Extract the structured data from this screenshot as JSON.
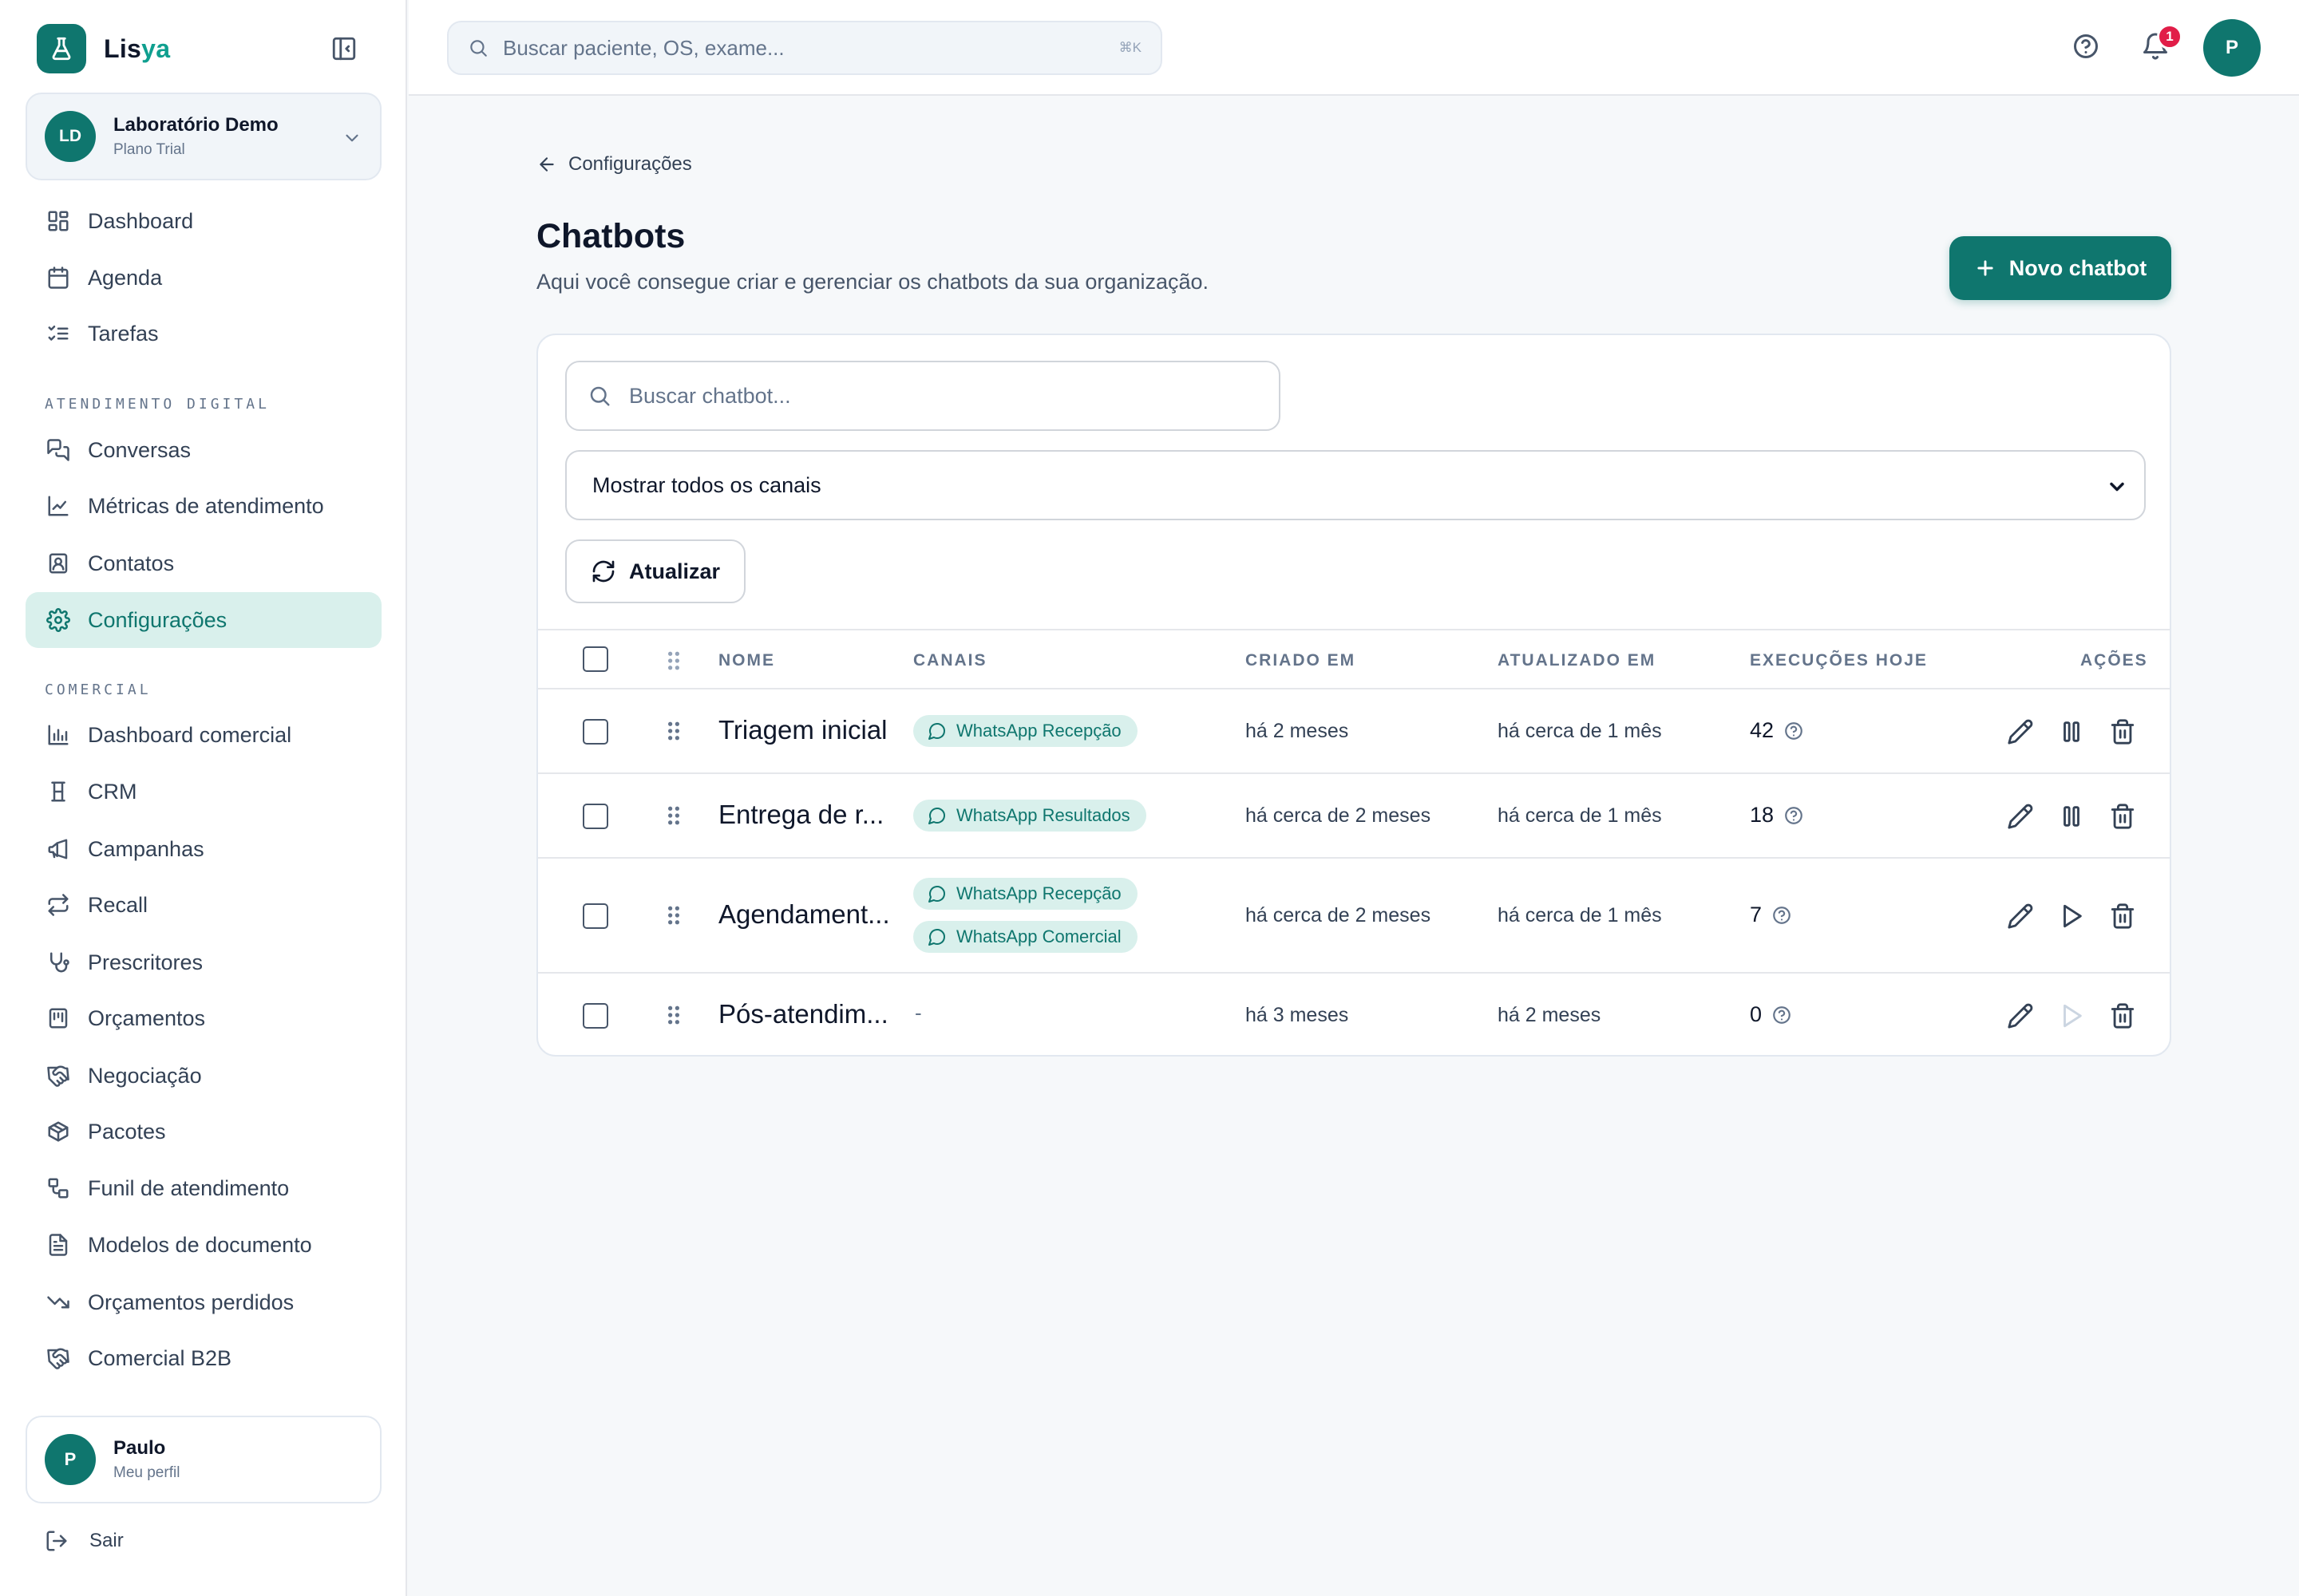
{
  "brand": {
    "name_main": "Lis",
    "name_accent": "ya"
  },
  "org": {
    "initials": "LD",
    "name": "Laboratório Demo",
    "plan": "Plano Trial"
  },
  "nav": {
    "main": [
      {
        "label": "Dashboard",
        "icon": "dashboard-icon"
      },
      {
        "label": "Agenda",
        "icon": "calendar-icon"
      },
      {
        "label": "Tarefas",
        "icon": "tasks-icon"
      }
    ],
    "section_digital": "ATENDIMENTO DIGITAL",
    "digital": [
      {
        "label": "Conversas",
        "icon": "chat-icon"
      },
      {
        "label": "Métricas de atendimento",
        "icon": "line-chart-icon"
      },
      {
        "label": "Contatos",
        "icon": "contacts-icon"
      },
      {
        "label": "Configurações",
        "icon": "gear-icon",
        "active": true
      }
    ],
    "section_comercial": "COMERCIAL",
    "comercial": [
      {
        "label": "Dashboard comercial",
        "icon": "bar-chart-icon"
      },
      {
        "label": "CRM",
        "icon": "crm-icon"
      },
      {
        "label": "Campanhas",
        "icon": "megaphone-icon"
      },
      {
        "label": "Recall",
        "icon": "repeat-icon"
      },
      {
        "label": "Prescritores",
        "icon": "stethoscope-icon"
      },
      {
        "label": "Orçamentos",
        "icon": "budget-icon"
      },
      {
        "label": "Negociação",
        "icon": "handshake-icon"
      },
      {
        "label": "Pacotes",
        "icon": "package-icon"
      },
      {
        "label": "Funil de atendimento",
        "icon": "funnel-icon"
      },
      {
        "label": "Modelos de documento",
        "icon": "document-icon"
      },
      {
        "label": "Orçamentos perdidos",
        "icon": "trending-down-icon"
      },
      {
        "label": "Comercial B2B",
        "icon": "handshake-icon"
      }
    ]
  },
  "profile": {
    "initial": "P",
    "name": "Paulo",
    "sub": "Meu perfil"
  },
  "logout_label": "Sair",
  "topbar": {
    "search_placeholder": "Buscar paciente, OS, exame...",
    "search_shortcut": "⌘K",
    "notification_count": "1",
    "avatar_initial": "P"
  },
  "page": {
    "breadcrumb": "Configurações",
    "title": "Chatbots",
    "description": "Aqui você consegue criar e gerenciar os chatbots da sua organização.",
    "new_button": "Novo chatbot",
    "search_placeholder": "Buscar chatbot...",
    "channel_filter": "Mostrar todos os canais",
    "refresh_button": "Atualizar"
  },
  "table": {
    "headers": {
      "name": "NOME",
      "channels": "CANAIS",
      "created": "CRIADO EM",
      "updated": "ATUALIZADO EM",
      "executions": "EXECUÇÕES HOJE",
      "actions": "AÇÕES"
    },
    "rows": [
      {
        "name": "Triagem inicial",
        "channels": [
          "WhatsApp Recepção"
        ],
        "created": "há 2 meses",
        "updated": "há cerca de 1 mês",
        "executions": "42",
        "state": "running"
      },
      {
        "name": "Entrega de r...",
        "channels": [
          "WhatsApp Resultados"
        ],
        "created": "há cerca de 2 meses",
        "updated": "há cerca de 1 mês",
        "executions": "18",
        "state": "running"
      },
      {
        "name": "Agendament...",
        "channels": [
          "WhatsApp Recepção",
          "WhatsApp Comercial"
        ],
        "created": "há cerca de 2 meses",
        "updated": "há cerca de 1 mês",
        "executions": "7",
        "state": "paused"
      },
      {
        "name": "Pós-atendim...",
        "channels": [],
        "empty_channels": "-",
        "created": "há 3 meses",
        "updated": "há 2 meses",
        "executions": "0",
        "state": "disabled"
      }
    ]
  },
  "colors": {
    "accent": "#0f766e",
    "accent_light": "#d9f0ec",
    "badge": "#e11d48"
  }
}
